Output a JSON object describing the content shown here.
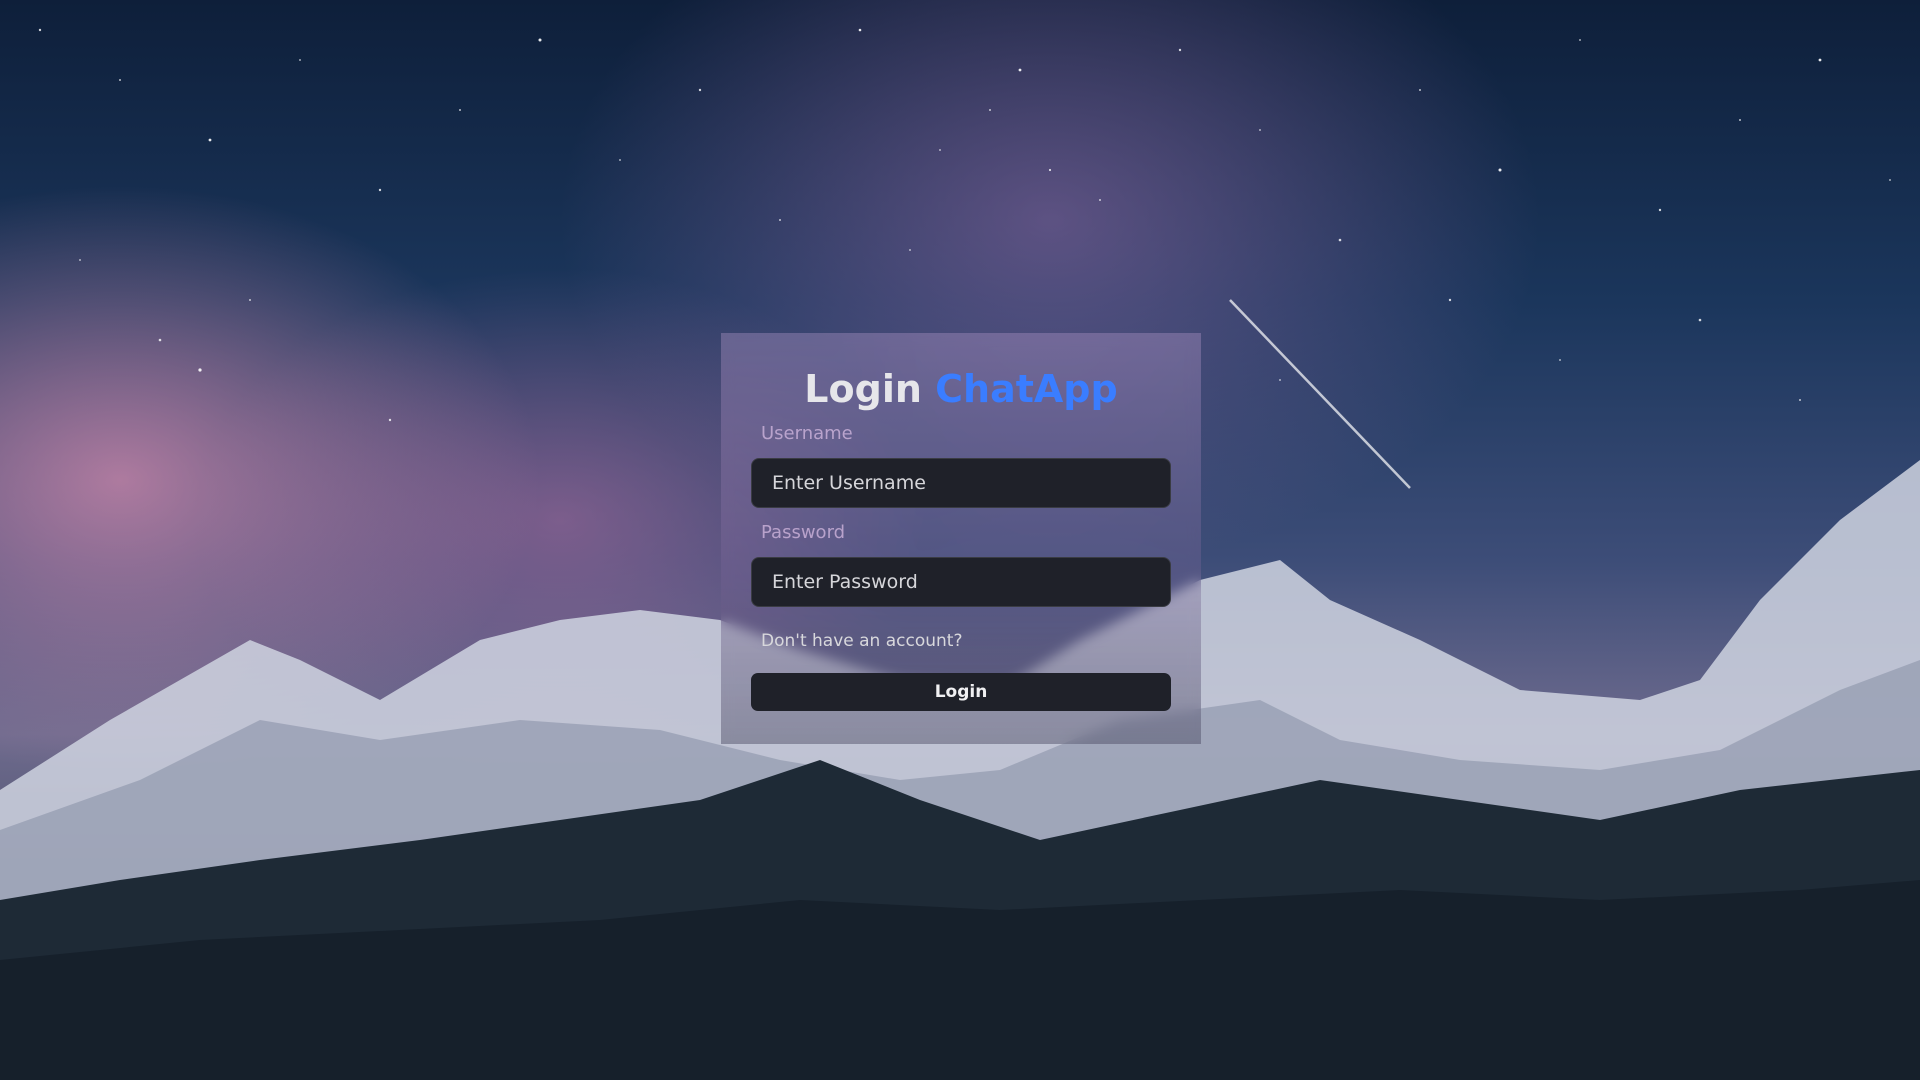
{
  "login": {
    "title": "Login",
    "brand": "ChatApp",
    "username_label": "Username",
    "username_placeholder": "Enter Username",
    "username_value": "",
    "password_label": "Password",
    "password_placeholder": "Enter Password",
    "password_value": "",
    "signup_link": "Don't have an account?",
    "submit_label": "Login"
  },
  "colors": {
    "brand": "#3a7dff",
    "input_bg": "#1f2129",
    "button_bg": "#1f2129"
  }
}
